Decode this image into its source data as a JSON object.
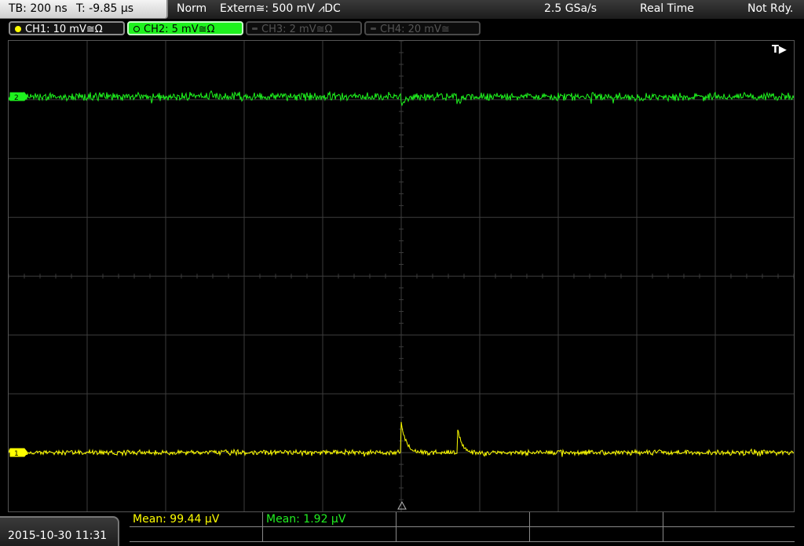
{
  "topbar": {
    "timebase": "TB: 200 ns",
    "trigger_offset": "T: -9.85 µs",
    "trigger_mode": "Norm",
    "trigger_source": "Extern≅: 500 mV ⩘DC",
    "sample_rate": "2.5 GSa/s",
    "acquisition_mode": "Real Time",
    "status": "Not Rdy."
  },
  "channels": [
    {
      "label": "CH1: 10 mV≅Ω",
      "color": "#ffff00",
      "state": "on"
    },
    {
      "label": "CH2: 5 mV≅Ω",
      "color": "#1ef21e",
      "state": "selected"
    },
    {
      "label": "CH3: 2 mV≅Ω",
      "color": "#555555",
      "state": "off"
    },
    {
      "label": "CH4: 20 mV≅",
      "color": "#555555",
      "state": "off"
    }
  ],
  "screen": {
    "trigger_marker": "T▶",
    "ch1_marker": "1",
    "ch2_marker": "2"
  },
  "footer": {
    "datetime": "2015-10-30 11:31",
    "measurements": [
      {
        "text": "Mean: 99.44 µV",
        "channel": "CH1",
        "color": "#ffff00"
      },
      {
        "text": "Mean: 1.92 µV",
        "channel": "CH2",
        "color": "#22ee22"
      }
    ]
  },
  "colors": {
    "ch1": "#ffff00",
    "ch2": "#1ef21e",
    "grid": "#3c3c3c",
    "background": "#000000"
  }
}
